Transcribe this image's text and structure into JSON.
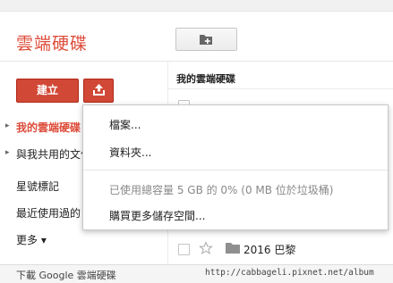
{
  "app": {
    "title": "雲端硬碟"
  },
  "toolbar": {
    "create_label": "建立",
    "new_folder_icon": "new-folder-icon",
    "upload_icon": "upload-icon"
  },
  "breadcrumb": "我的雲端硬碟",
  "sidebar": {
    "items": [
      {
        "label": "我的雲端硬碟",
        "active": true,
        "has_arrow": true
      },
      {
        "label": "與我共用的文件",
        "active": false,
        "has_arrow": true
      },
      {
        "label": "星號標記",
        "active": false,
        "has_arrow": false
      },
      {
        "label": "最近使用過的",
        "active": false,
        "has_arrow": false
      },
      {
        "label": "更多 ▾",
        "active": false,
        "has_arrow": false
      }
    ]
  },
  "upload_menu": {
    "items": [
      {
        "label": "檔案..."
      },
      {
        "label": "資料夾..."
      }
    ],
    "storage_info": "已使用總容量 5 GB 的 0% (0 MB 位於垃圾桶)",
    "buy_storage": "購買更多儲存空間..."
  },
  "file_list": {
    "rows": [
      {
        "name": "2016 巴黎",
        "type": "folder",
        "starred": false
      }
    ]
  },
  "footer": {
    "download_link": "下載 Google 雲端硬碟",
    "watermark": "http://cabbageli.pixnet.net/album"
  },
  "colors": {
    "accent": "#dd4b39",
    "button_red": "#d14836"
  }
}
